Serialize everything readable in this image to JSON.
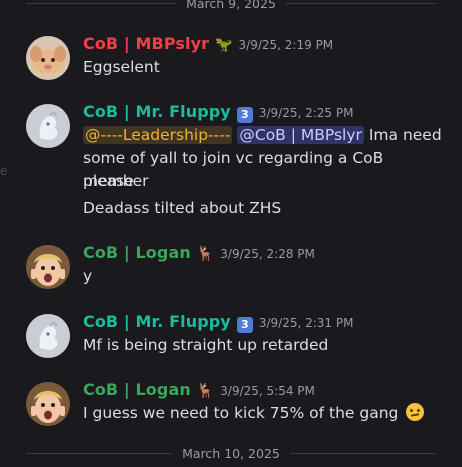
{
  "date_dividers": [
    "March 9, 2025",
    "March 10, 2025"
  ],
  "colors": {
    "red_role": "#f23f43",
    "teal_role": "#1abc9c",
    "green_role": "#3ba55c",
    "leadership": "#f0b232",
    "mention": "#5865f2"
  },
  "messages": [
    {
      "author": "CoB | MBPslyr",
      "author_color": "#f23f43",
      "badge_icon": "dinosaur-icon",
      "timestamp": "3/9/25, 2:19 PM",
      "lines": [
        "Eggselent"
      ]
    },
    {
      "author": "CoB | Mr. Fluppy",
      "author_color": "#1abc9c",
      "badge": "3",
      "timestamp": "3/9/25, 2:25 PM",
      "role_mention": "@----Leadership----",
      "user_mention": "@CoB | MBPslyr",
      "text_after_mention": "Ima need",
      "line2": "some of yall to join vc regarding a CoB member",
      "line3": "please",
      "followup": "Deadass tilted about ZHS"
    },
    {
      "author": "CoB | Logan",
      "author_color": "#3ba55c",
      "badge_icon": "deer-icon",
      "timestamp": "3/9/25, 2:28 PM",
      "lines": [
        "y"
      ]
    },
    {
      "author": "CoB | Mr. Fluppy",
      "author_color": "#1abc9c",
      "badge": "3",
      "timestamp": "3/9/25, 2:31 PM",
      "lines": [
        "Mf is being straight up retarded"
      ]
    },
    {
      "author": "CoB | Logan",
      "author_color": "#3ba55c",
      "badge_icon": "deer-icon",
      "timestamp": "3/9/25, 5:54 PM",
      "lines": [
        "I guess we need to kick 75% of the gang"
      ],
      "emoji": "grimacing-face-emoji"
    }
  ]
}
